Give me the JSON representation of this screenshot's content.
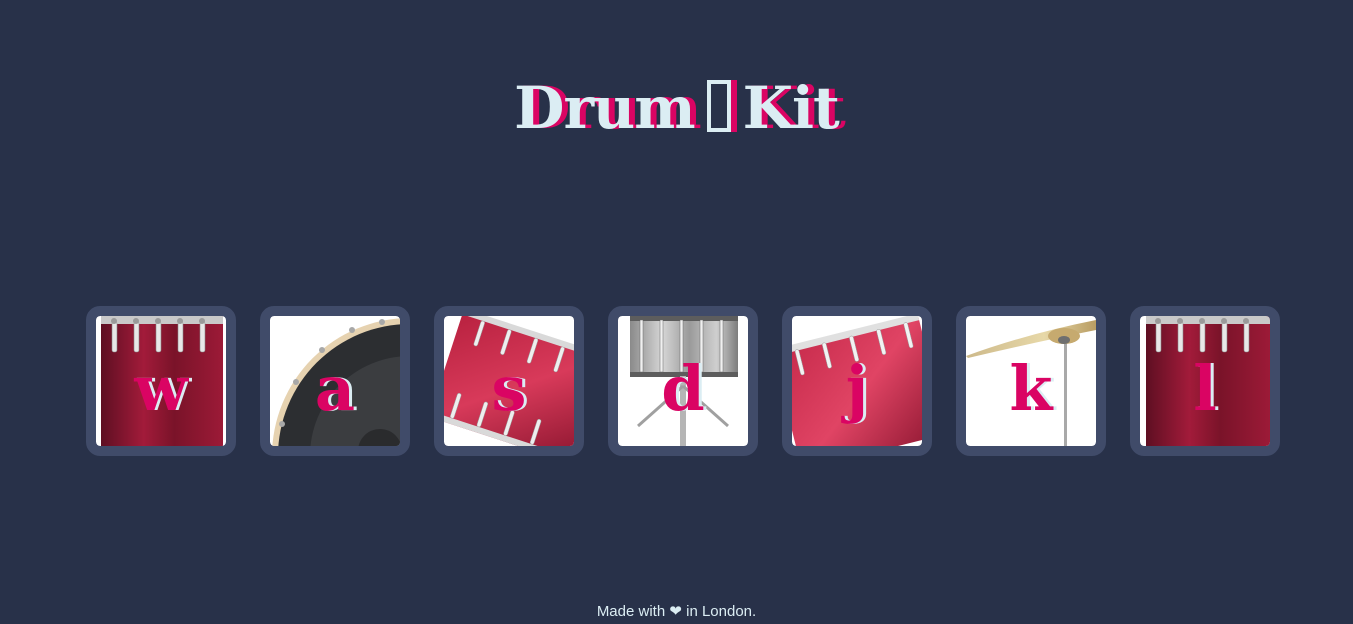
{
  "header": {
    "title_part1": "Drum",
    "title_part2": "Kit",
    "title_glyph_icon": "missing-glyph-box",
    "color_text": "#DBEDF3",
    "color_accent": "#DA0463",
    "color_background": "#283149",
    "color_pad": "#404B69"
  },
  "pads": [
    {
      "key": "w",
      "instrument_icon": "tom-drum-icon"
    },
    {
      "key": "a",
      "instrument_icon": "bass-drum-icon"
    },
    {
      "key": "s",
      "instrument_icon": "snare-drum-icon"
    },
    {
      "key": "d",
      "instrument_icon": "silver-drum-icon"
    },
    {
      "key": "j",
      "instrument_icon": "crash-drum-icon"
    },
    {
      "key": "k",
      "instrument_icon": "cymbal-icon"
    },
    {
      "key": "l",
      "instrument_icon": "floor-tom-icon"
    }
  ],
  "footer": {
    "prefix": "Made with",
    "heart_icon": "heart-icon",
    "suffix": "in London."
  }
}
